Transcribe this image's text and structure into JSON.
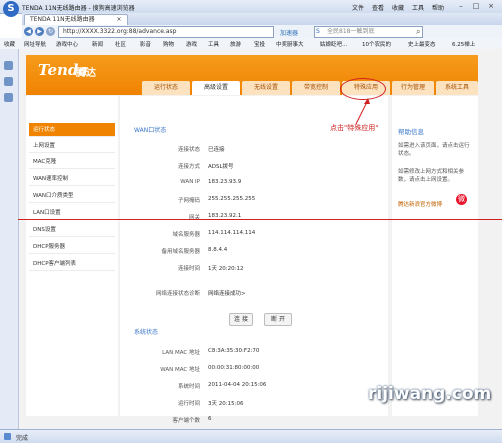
{
  "window": {
    "title": "TENDA 11N无线路由器 - 搜狗高速浏览器",
    "menu": [
      "文件",
      "查看",
      "收藏",
      "工具",
      "帮助"
    ]
  },
  "tab": {
    "label": "TENDA 11N无线路由器"
  },
  "address": {
    "url": "http://XXXX.3322.org:88/advance.asp",
    "accelerator": "加速器",
    "search_placeholder": "全民818一触到底"
  },
  "favorites": [
    "收藏",
    "网址导航",
    "游戏中心",
    "新闻",
    "社区",
    "影音",
    "购物",
    "游戏",
    "工具",
    "旅游",
    "宝投",
    "中奖厨事大",
    "姑娘眨吧...",
    "10个农民的",
    "史上最变态",
    "6.25禅上"
  ],
  "brand": {
    "logo": "Tenda",
    "logo_cn": "腾达"
  },
  "main_tabs": [
    "运行状态",
    "高级设置",
    "无线设置",
    "带宽控制",
    "特殊应用",
    "行为管理",
    "系统工具"
  ],
  "sidebar": [
    "运行状态",
    "上网设置",
    "MAC克隆",
    "WAN速率控制",
    "WAN口介质类型",
    "LAN口设置",
    "DNS设置",
    "DHCP服务器",
    "DHCP客户端列表"
  ],
  "wan": {
    "section": "WAN口状态",
    "rows": [
      {
        "label": "连接状态",
        "value": "已连接"
      },
      {
        "label": "连接方式",
        "value": "ADSL拨号"
      },
      {
        "label": "WAN IP",
        "value": "183.23.93.9"
      },
      {
        "label": "子网掩码",
        "value": "255.255.255.255"
      },
      {
        "label": "网关",
        "value": "183.23.92.1"
      },
      {
        "label": "域名服务器",
        "value": "114.114.114.114"
      },
      {
        "label": "备用域名服务器",
        "value": "8.8.4.4"
      },
      {
        "label": "连接时间",
        "value": "1天 20:20:12"
      }
    ],
    "diag_label": "网络连接状态诊断",
    "diag_value": "网络连接成功>",
    "connect_btn": "连 接",
    "disconnect_btn": "断 开"
  },
  "system": {
    "section": "系统状态",
    "rows": [
      {
        "label": "LAN MAC 地址",
        "value": "C8:3A:35:30:F2:70"
      },
      {
        "label": "WAN MAC 地址",
        "value": "00:00:31:80:00:00"
      },
      {
        "label": "系统时间",
        "value": "2011-04-04 20:15:06"
      },
      {
        "label": "运行时间",
        "value": "3天 20:15:06"
      },
      {
        "label": "客户端个数",
        "value": "6"
      }
    ]
  },
  "help": {
    "title": "帮助信息",
    "text1": "如需进入该页面，请点击运行状态。",
    "text2": "如需修改上网方式和相关参数，请点击上网设置。",
    "weibo": "腾达新浪官方微博"
  },
  "annotation": "点击\"特殊应用\"",
  "status": {
    "text": "完成"
  },
  "watermark": "rijiwang.com",
  "colors": {
    "brand_orange": "#f08300",
    "annotation_red": "#d12020"
  }
}
